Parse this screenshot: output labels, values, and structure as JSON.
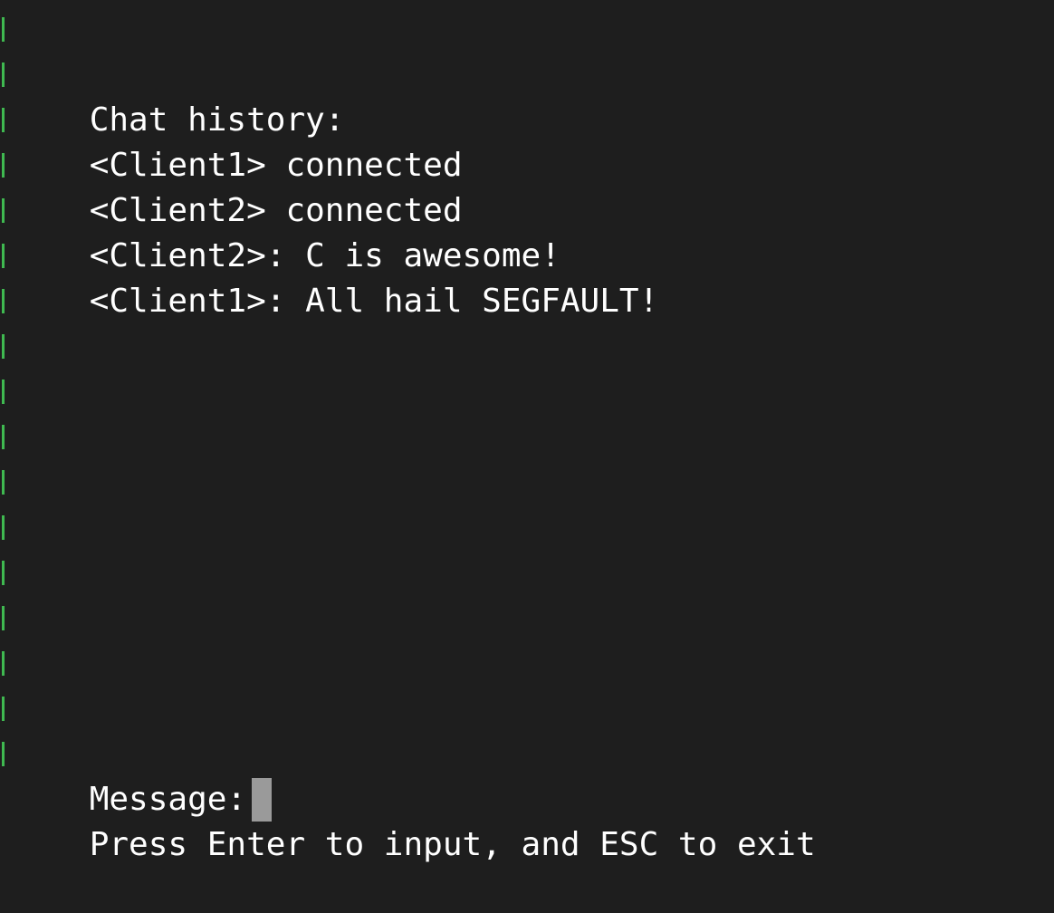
{
  "chat": {
    "header": "Chat history:",
    "messages": [
      "<Client1> connected",
      "<Client2> connected",
      "<Client2>: C is awesome!",
      "<Client1>: All hail SEGFAULT!"
    ]
  },
  "input": {
    "prompt_label": "Message:",
    "value": ""
  },
  "help": {
    "text": "Press Enter to input, and ESC to exit"
  },
  "colors": {
    "background": "#1e1e1e",
    "text": "#ffffff",
    "line_marker": "#3fb950",
    "cursor": "#9a9a9a"
  }
}
